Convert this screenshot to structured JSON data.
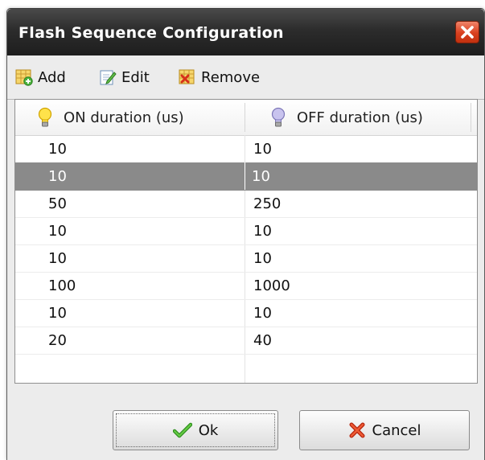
{
  "window": {
    "title": "Flash Sequence Configuration"
  },
  "toolbar": {
    "add_label": "Add",
    "edit_label": "Edit",
    "remove_label": "Remove"
  },
  "table": {
    "columns": [
      "ON duration (us)",
      "OFF duration (us)"
    ],
    "rows": [
      [
        "10",
        "10"
      ],
      [
        "10",
        "10"
      ],
      [
        "50",
        "250"
      ],
      [
        "10",
        "10"
      ],
      [
        "10",
        "10"
      ],
      [
        "100",
        "1000"
      ],
      [
        "10",
        "10"
      ],
      [
        "20",
        "40"
      ]
    ],
    "selected_row": 1
  },
  "buttons": {
    "ok_label": "Ok",
    "cancel_label": "Cancel"
  },
  "icons": {
    "close": "close-icon",
    "add": "add-grid-icon",
    "edit": "edit-icon",
    "remove": "remove-grid-icon",
    "on_bulb": "lightbulb-on-icon",
    "off_bulb": "lightbulb-off-icon",
    "ok": "checkmark-icon",
    "cancel": "cross-icon"
  },
  "colors": {
    "titlebar": "#2c2c2c",
    "selection": "#8a8a8a",
    "close_button": "#d9401f"
  }
}
